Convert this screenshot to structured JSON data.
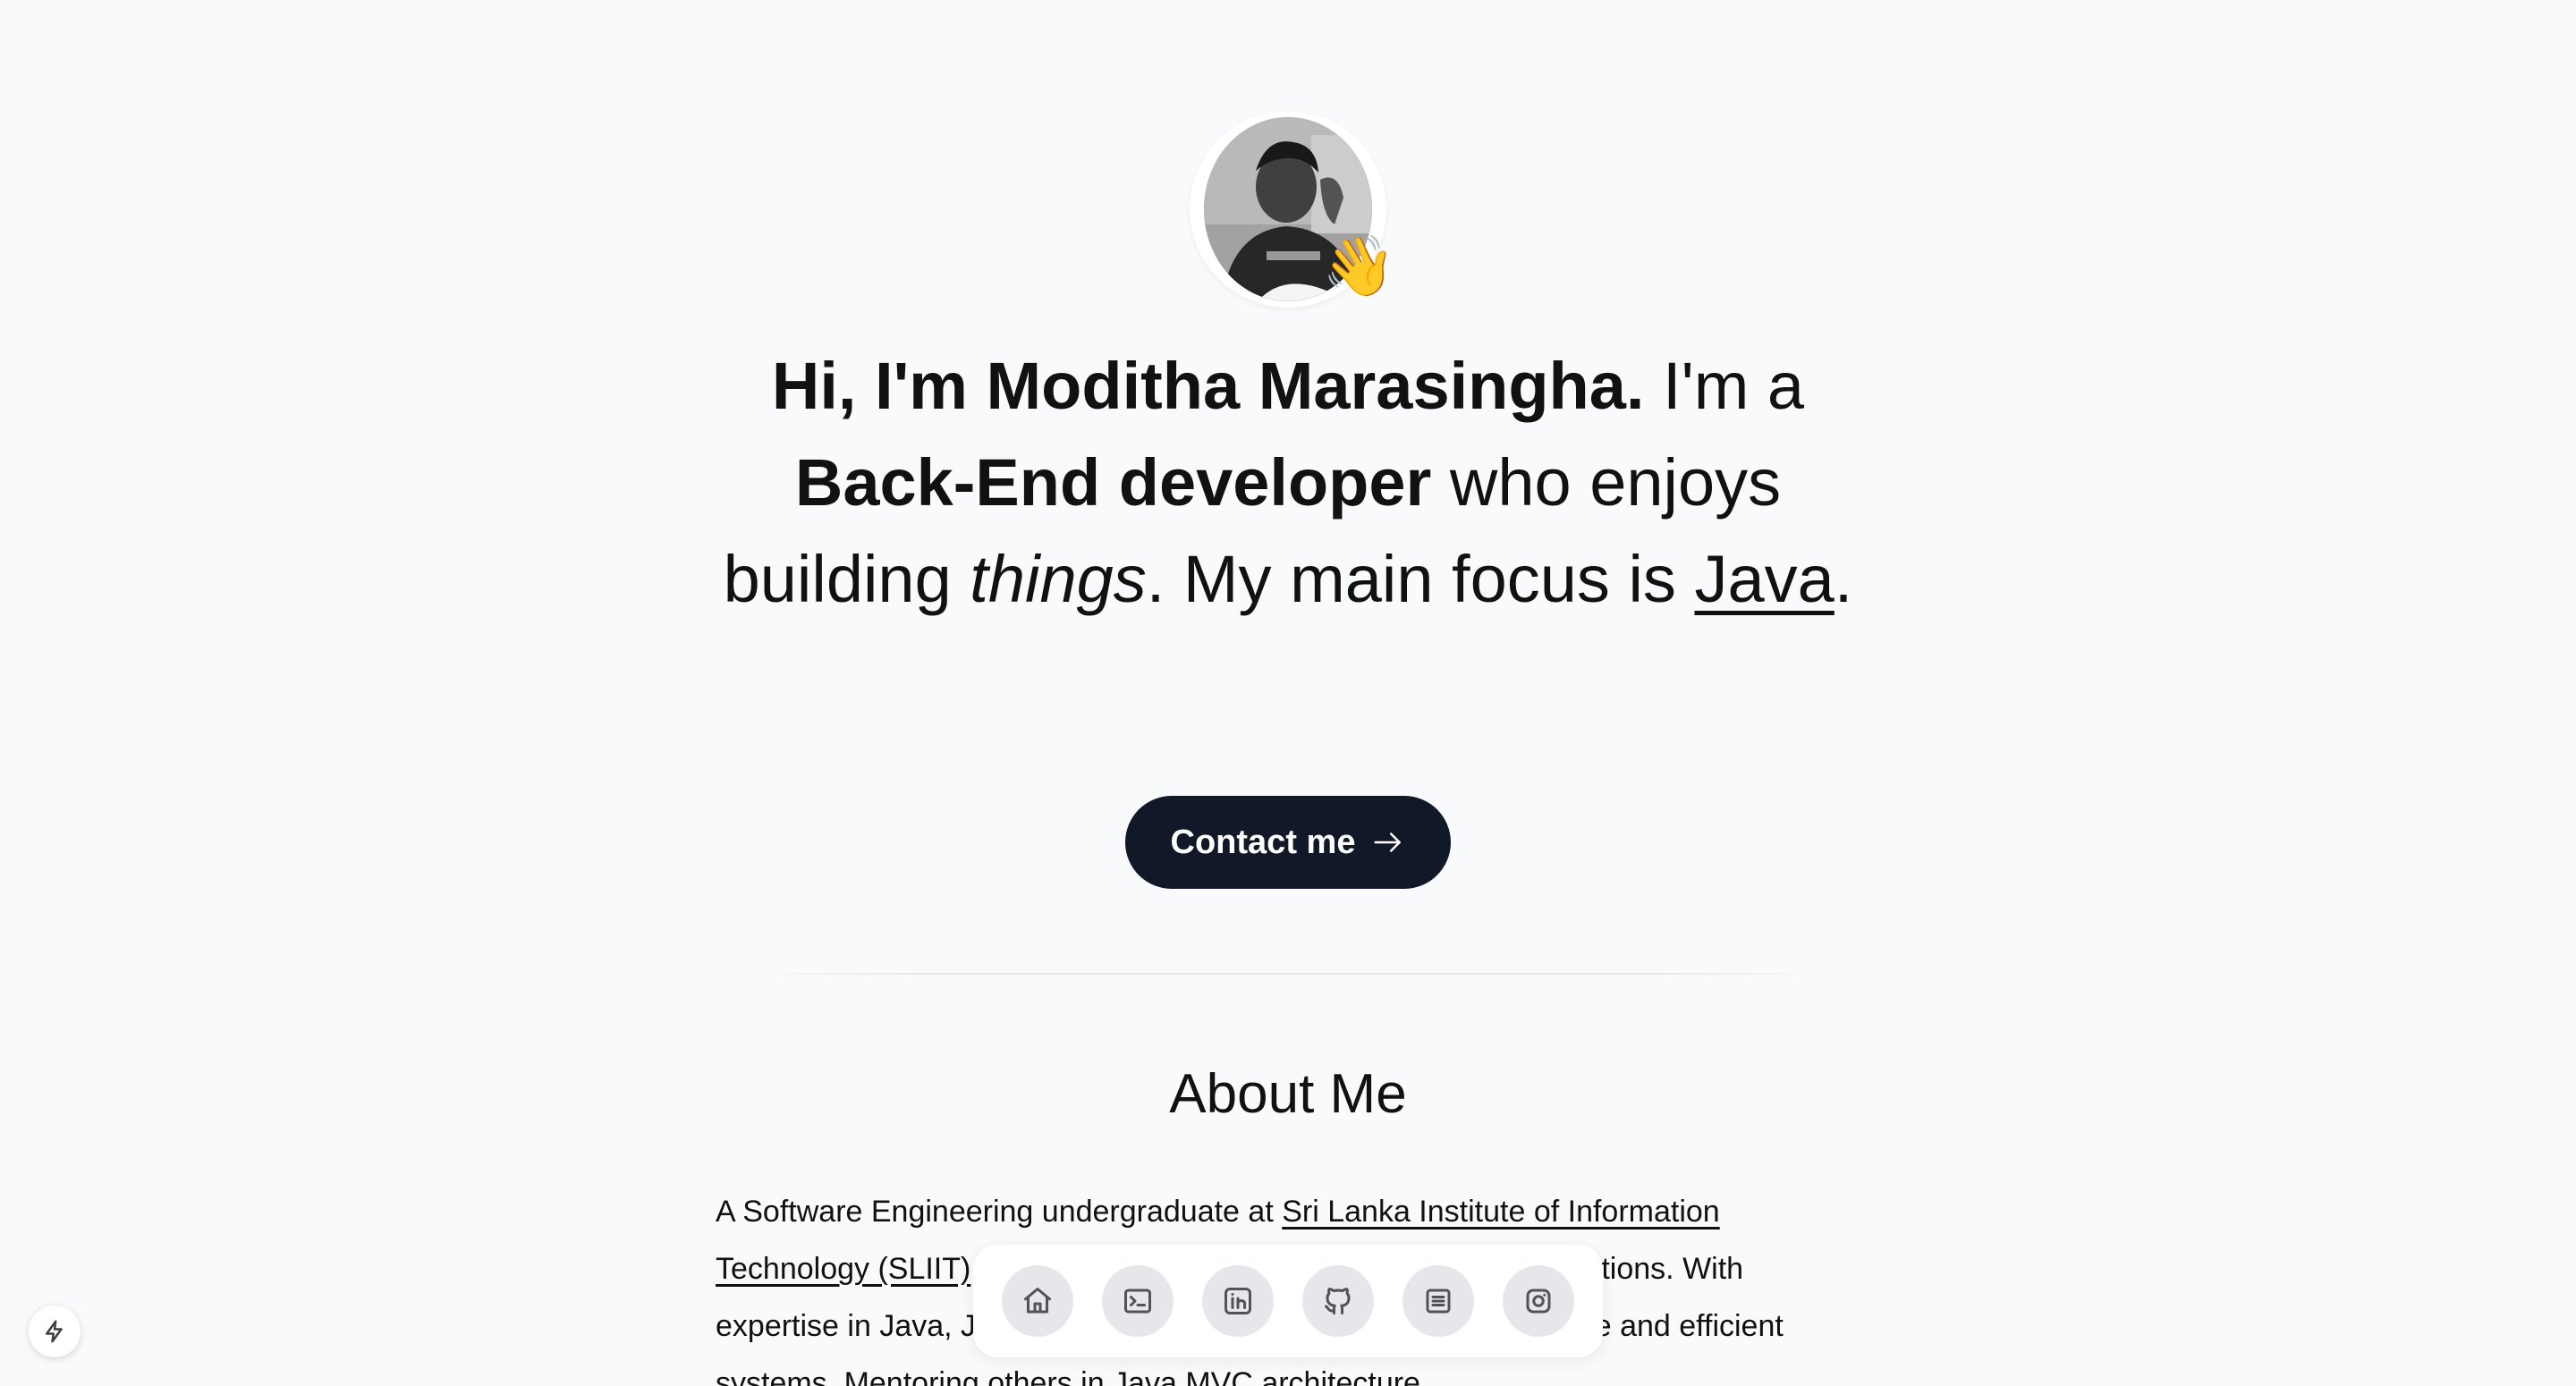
{
  "hero": {
    "avatar_alt": "Moditha Marasingha profile photo",
    "wave_emoji": "👋",
    "greeting": "Hi, I'm Moditha Marasingha.",
    "text_im_a": " I'm a ",
    "role": "Back-End developer",
    "text_who_enjoys": " who enjoys building ",
    "things": "things",
    "text_main_focus": ". My main focus is ",
    "focus": "Java",
    "period": "."
  },
  "contact_button": {
    "label": "Contact me",
    "icon": "arrow-right-icon"
  },
  "about": {
    "title": "About Me",
    "text_before_link": "A Software Engineering undergraduate at ",
    "link_label": "Sri Lanka Institute of Information Technology (SLIIT)",
    "text_after_link": ", passionate about crafting innovative web solutions. With expertise in Java, JavaScript and MySQL, I enjoy building scalable and efficient systems. Mentoring others in Java MVC architecture"
  },
  "dock": {
    "items": [
      {
        "label": "Home",
        "icon": "home-icon"
      },
      {
        "label": "Terminal",
        "icon": "terminal-icon"
      },
      {
        "label": "LinkedIn",
        "icon": "linkedin-icon"
      },
      {
        "label": "GitHub",
        "icon": "github-icon"
      },
      {
        "label": "Resume",
        "icon": "document-icon"
      },
      {
        "label": "Instagram",
        "icon": "instagram-icon"
      }
    ]
  },
  "corner_badge": {
    "icon": "lightning-icon"
  },
  "colors": {
    "background": "#f9fafb",
    "button": "#111827",
    "text": "#111111",
    "dock_item": "#e5e7eb"
  }
}
